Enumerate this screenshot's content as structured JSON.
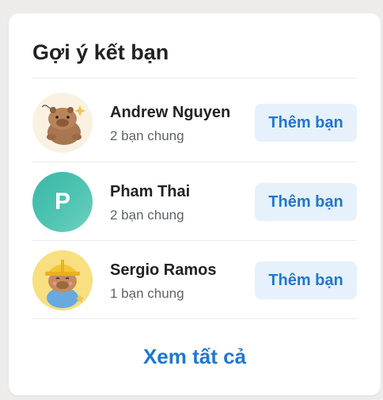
{
  "card": {
    "title": "Gợi ý kết bạn",
    "see_all_label": "Xem tất cả"
  },
  "suggestions": [
    {
      "name": "Andrew Nguyen",
      "mutual": "2 bạn chung",
      "action_label": "Thêm bạn",
      "avatar_icon": "capybara-sticker-icon"
    },
    {
      "name": "Pham Thai",
      "mutual": "2 bạn chung",
      "action_label": "Thêm bạn",
      "avatar_letter": "P"
    },
    {
      "name": "Sergio Ramos",
      "mutual": "1 bạn chung",
      "action_label": "Thêm bạn",
      "avatar_icon": "capybara-hardhat-icon"
    }
  ],
  "colors": {
    "accent": "#1f77d0",
    "button_bg": "#e7f1fc",
    "avatar_teal": "#44bcac"
  }
}
